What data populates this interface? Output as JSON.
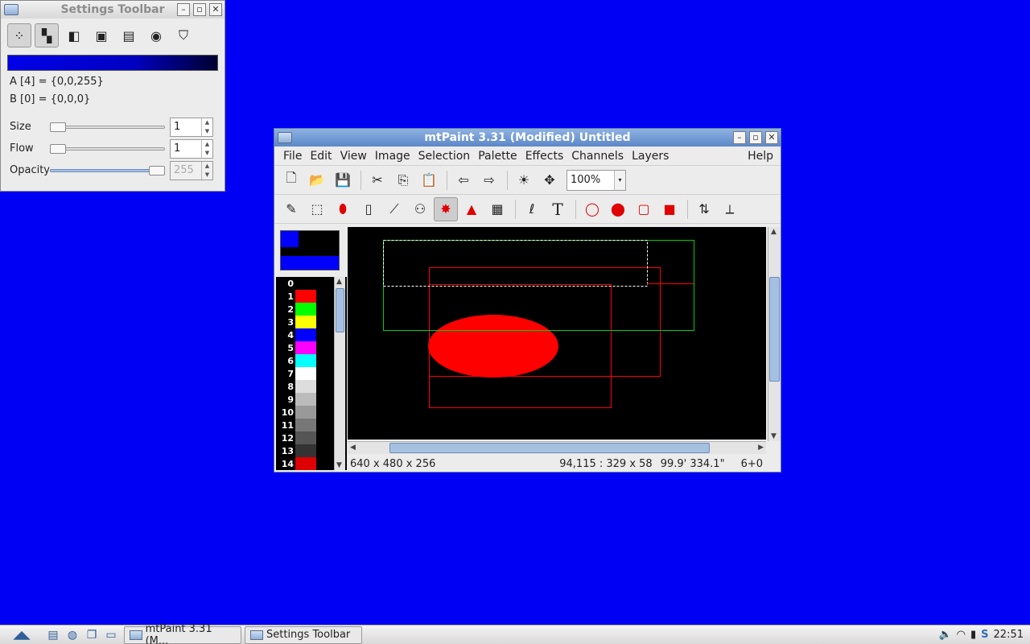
{
  "settings_window": {
    "title": "Settings Toolbar",
    "tools": [
      {
        "name": "brush-settings-icon",
        "glyph": "⁘",
        "pressed": true
      },
      {
        "name": "pattern-icon",
        "glyph": "▚",
        "pressed": true
      },
      {
        "name": "gradient-icon",
        "glyph": "◧",
        "pressed": false
      },
      {
        "name": "mask-icon",
        "glyph": "▣",
        "pressed": false
      },
      {
        "name": "blend-mode-icon",
        "glyph": "▤",
        "pressed": false
      },
      {
        "name": "color-wheel-icon",
        "glyph": "◉",
        "pressed": false
      },
      {
        "name": "shield-icon",
        "glyph": "⛉",
        "pressed": false
      }
    ],
    "color_a": "A [4] = {0,0,255}",
    "color_b": "B [0] = {0,0,0}",
    "size": {
      "label": "Size",
      "value": "1",
      "level": 0.0
    },
    "flow": {
      "label": "Flow",
      "value": "1",
      "level": 0.0
    },
    "opacity": {
      "label": "Opacity",
      "value": "255",
      "level": 1.0
    }
  },
  "main_window": {
    "title": "mtPaint 3.31 (Modified) Untitled",
    "menus": [
      "File",
      "Edit",
      "View",
      "Image",
      "Selection",
      "Palette",
      "Effects",
      "Channels",
      "Layers"
    ],
    "help_menu": "Help",
    "toolbar1": [
      {
        "name": "new-file-icon",
        "glyph": "🗋"
      },
      {
        "name": "open-folder-icon",
        "glyph": "📂"
      },
      {
        "name": "save-icon",
        "glyph": "💾"
      },
      {
        "name": "cut-icon",
        "glyph": "✂"
      },
      {
        "name": "copy-icon",
        "glyph": "⎘"
      },
      {
        "name": "paste-icon",
        "glyph": "📋"
      },
      {
        "name": "undo-icon",
        "glyph": "⇦"
      },
      {
        "name": "redo-icon",
        "glyph": "⇨"
      },
      {
        "name": "sun-icon",
        "glyph": "☀"
      },
      {
        "name": "move-arrows-icon",
        "glyph": "✥"
      }
    ],
    "zoom": "100%",
    "toolbar2": [
      {
        "name": "pencil-icon",
        "glyph": "✎",
        "pressed": false
      },
      {
        "name": "select-icon",
        "glyph": "⬚",
        "pressed": false
      },
      {
        "name": "fill-bucket-icon",
        "glyph": "⬮",
        "pressed": false
      },
      {
        "name": "line-icon",
        "glyph": "▯",
        "pressed": false
      },
      {
        "name": "smudge-icon",
        "glyph": "⟋",
        "pressed": false
      },
      {
        "name": "clone-icon",
        "glyph": "⚇",
        "pressed": false
      },
      {
        "name": "paint-brush-icon",
        "glyph": "✸",
        "pressed": true
      },
      {
        "name": "flood-fill-icon",
        "glyph": "▲",
        "pressed": false
      },
      {
        "name": "gradient-tool-icon",
        "glyph": "▦",
        "pressed": false
      },
      {
        "name": "lasso-icon",
        "glyph": "ℓ",
        "pressed": false
      },
      {
        "name": "text-icon",
        "glyph": "T",
        "pressed": false
      },
      {
        "name": "ellipse-outline-icon",
        "glyph": "◯",
        "pressed": false
      },
      {
        "name": "ellipse-fill-icon",
        "glyph": "⬤",
        "pressed": false
      },
      {
        "name": "rect-outline-icon",
        "glyph": "▢",
        "pressed": false
      },
      {
        "name": "rect-fill-icon",
        "glyph": "■",
        "pressed": false
      },
      {
        "name": "flip-vertical-icon",
        "glyph": "⇅",
        "pressed": false
      },
      {
        "name": "flip-horizontal-icon",
        "glyph": "⟂",
        "pressed": false
      }
    ],
    "palette": [
      {
        "index": "0",
        "color": "#000000"
      },
      {
        "index": "1",
        "color": "#ff0000"
      },
      {
        "index": "2",
        "color": "#00ff00"
      },
      {
        "index": "3",
        "color": "#ffff00"
      },
      {
        "index": "4",
        "color": "#0000ff"
      },
      {
        "index": "5",
        "color": "#ff00ff"
      },
      {
        "index": "6",
        "color": "#00ffff"
      },
      {
        "index": "7",
        "color": "#ffffff"
      },
      {
        "index": "8",
        "color": "#dddddd"
      },
      {
        "index": "9",
        "color": "#bbbbbb"
      },
      {
        "index": "10",
        "color": "#999999"
      },
      {
        "index": "11",
        "color": "#777777"
      },
      {
        "index": "12",
        "color": "#555555"
      },
      {
        "index": "13",
        "color": "#333333"
      },
      {
        "index": "14",
        "color": "#dd0000"
      }
    ],
    "status": {
      "dimensions": "640 x 480 x 256",
      "selection": "94,115 : 329 x 58",
      "angle": "99.9' 334.1\"",
      "layer": "6+0"
    }
  },
  "taskbar": {
    "tasks": [
      "mtPaint 3.31 (M...",
      "Settings Toolbar"
    ],
    "clock": "22:51"
  }
}
